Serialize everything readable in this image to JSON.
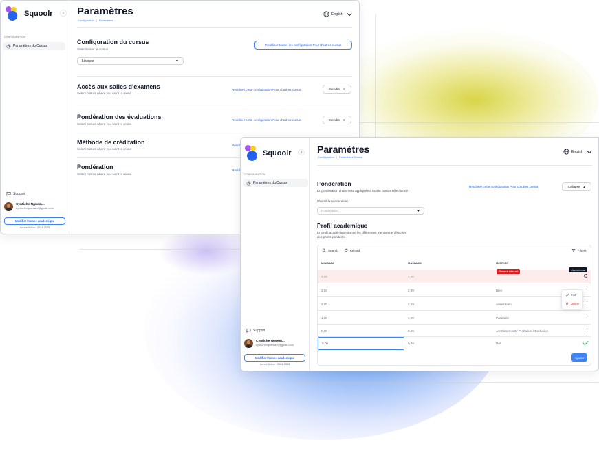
{
  "app": {
    "name": "Squoolr"
  },
  "nav": {
    "section_label": "CONFIGURATION",
    "item": "Paramètres du Cursus"
  },
  "sidebar": {
    "support": "Support",
    "user_name": "Cyntiche Nguem...",
    "user_email": "cyntichenguemaro@gmail.com",
    "edit_year_button": "Modifier l'annee academique",
    "academic_year": "Annee Active : 2024-2025"
  },
  "header": {
    "title": "Paramètres",
    "language": "English"
  },
  "back_window": {
    "breadcrumb": [
      "Configuration",
      "Paramètres"
    ],
    "config": {
      "title": "Configuration du cursus",
      "subtitle": "Selectionner le cursus",
      "reuse_all_button": "Reutiliser toutes les configuration Pour d'autres cursus",
      "select_value": "Licence"
    },
    "sections": [
      {
        "title": "Accès aux salles d'examens",
        "subtitle": "Select cursus where you want to reuse",
        "link": "Reutiliser cette configuration Pour d'autres cursus",
        "button": "Etendre"
      },
      {
        "title": "Pondération des évaluations",
        "subtitle": "Select cursus where you want to reuse",
        "link": "Reutiliser cette configuration Pour d'autres cursus",
        "button": "Etendre"
      },
      {
        "title": "Méthode de créditation",
        "subtitle": "Select cursus where you want to reuse",
        "link": "Reutili"
      },
      {
        "title": "Pondération",
        "subtitle": "Select cursus where you want to reuse",
        "link": "Reutili"
      }
    ]
  },
  "front_window": {
    "breadcrumb": [
      "Configuration",
      "Paramètres Cursus"
    ],
    "ponderation": {
      "title": "Pondération",
      "subtitle": "La ponderation choisi sera appliquée a tout le cursus sélectionné",
      "link": "Reutiliser cette configuration Pour d'autres cursus",
      "collapse_button": "Collapse",
      "choose_label": "Choisir la ponderation",
      "select_placeholder": "Ponderation"
    },
    "profil": {
      "title": "Profil academique",
      "description_line1": "Le profil académique donne les différentes mentions en fonction",
      "description_line2": "des points pondérés"
    },
    "table": {
      "search_label": "Search",
      "reload_label": "Reload",
      "filters_label": "Filters",
      "columns": [
        "MINIMUM",
        "MAXIMUM",
        "MENTION"
      ],
      "rows": [
        {
          "min": "3,00",
          "max": "4,00",
          "mention": ""
        },
        {
          "min": "2,50",
          "max": "2,99",
          "mention": "Bien"
        },
        {
          "min": "2,00",
          "max": "2,49",
          "mention": "Assez-bien"
        },
        {
          "min": "1,00",
          "max": "1,99",
          "mention": "Passable"
        },
        {
          "min": "0,00",
          "max": "0,99",
          "mention": "Avertissement / Probation / Exclusion"
        },
        {
          "min": "0,00",
          "max": "0,49",
          "mention": "Nul"
        }
      ],
      "error_badge": "Present interval",
      "tooltip": "Use interval",
      "menu_edit": "Edit",
      "menu_delete": "Delete",
      "add_button": "Ajouter"
    }
  },
  "colors": {
    "accent": "#3b82f6",
    "danger": "#e11d24",
    "success": "#22c55e"
  },
  "icons": [
    "chevron-left-icon",
    "settings-icon",
    "chat-icon",
    "globe-icon",
    "chevron-down-icon",
    "caret-down-icon",
    "caret-up-icon",
    "search-icon",
    "reload-icon",
    "filter-icon",
    "kebab-icon",
    "pencil-icon",
    "trash-icon",
    "check-icon",
    "refresh-icon"
  ]
}
